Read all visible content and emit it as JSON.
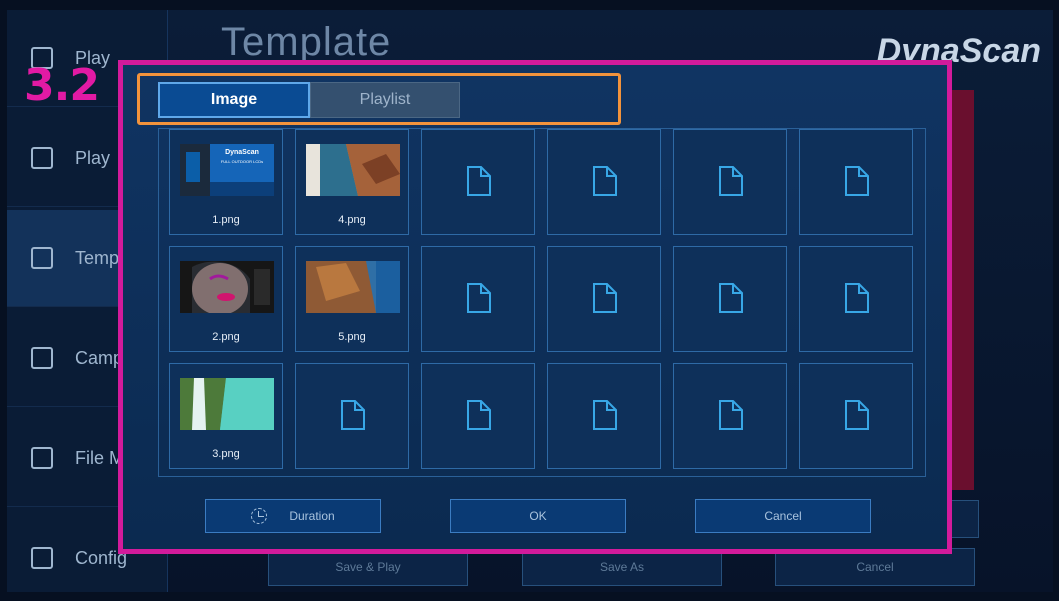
{
  "app": {
    "title": "Template",
    "brand": "DynaScan",
    "sidebar": [
      {
        "label": "Play",
        "icon": "play-icon"
      },
      {
        "label": "Play",
        "icon": "list-icon"
      },
      {
        "label": "Temp",
        "icon": "template-icon"
      },
      {
        "label": "Camp",
        "icon": "calendar-icon"
      },
      {
        "label": "File M",
        "icon": "folder-icon"
      },
      {
        "label": "Config",
        "icon": "wrench-icon"
      }
    ],
    "bottom_buttons": [
      "Save & Play",
      "Save As",
      "Cancel"
    ]
  },
  "annotation": {
    "step": "3.2",
    "color": "#e21aa4",
    "highlight_color": "#f2933c"
  },
  "dialog": {
    "tabs": [
      {
        "label": "Image",
        "active": true
      },
      {
        "label": "Playlist",
        "active": false
      }
    ],
    "files": [
      {
        "name": "1.png"
      },
      {
        "name": "4.png"
      },
      {
        "name": ""
      },
      {
        "name": ""
      },
      {
        "name": ""
      },
      {
        "name": ""
      },
      {
        "name": "2.png"
      },
      {
        "name": "5.png"
      },
      {
        "name": ""
      },
      {
        "name": ""
      },
      {
        "name": ""
      },
      {
        "name": ""
      },
      {
        "name": "3.png"
      },
      {
        "name": ""
      },
      {
        "name": ""
      },
      {
        "name": ""
      },
      {
        "name": ""
      },
      {
        "name": ""
      }
    ],
    "thumb1_text": {
      "brand": "DynaScan",
      "line1": "FULL OUTDOOR LCDs"
    },
    "buttons": {
      "duration": "Duration",
      "ok": "OK",
      "cancel": "Cancel"
    }
  }
}
